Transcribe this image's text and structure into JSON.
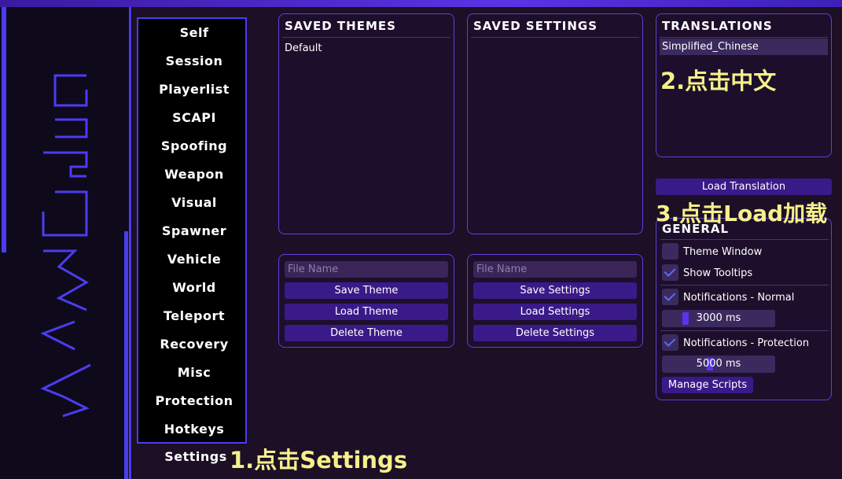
{
  "nav": {
    "items": [
      "Self",
      "Session",
      "Playerlist",
      "SCAPI",
      "Spoofing",
      "Weapon",
      "Visual",
      "Spawner",
      "Vehicle",
      "World",
      "Teleport",
      "Recovery",
      "Misc",
      "Protection",
      "Hotkeys",
      "Settings"
    ]
  },
  "themes": {
    "title": "SAVED THEMES",
    "items": [
      "Default"
    ],
    "file_placeholder": "File Name",
    "save": "Save Theme",
    "load": "Load Theme",
    "delete": "Delete Theme"
  },
  "settings": {
    "title": "SAVED SETTINGS",
    "file_placeholder": "File Name",
    "save": "Save Settings",
    "load": "Load Settings",
    "delete": "Delete Settings"
  },
  "translations": {
    "title": "TRANSLATIONS",
    "items": [
      "Simplified_Chinese"
    ],
    "load_button": "Load Translation"
  },
  "general": {
    "title": "GENERAL",
    "theme_window": {
      "label": "Theme Window",
      "checked": false
    },
    "show_tooltips": {
      "label": "Show Tooltips",
      "checked": true
    },
    "notif_normal": {
      "label": "Notifications - Normal",
      "checked": true,
      "value": "3000 ms"
    },
    "notif_protection": {
      "label": "Notifications - Protection",
      "checked": true,
      "value": "5000 ms"
    },
    "manage_scripts": "Manage Scripts"
  },
  "annotations": {
    "step1": "1.点击Settings",
    "step2": "2.点击中文",
    "step3": "3.点击Load加载"
  },
  "colors": {
    "accent": "#4b3cf0",
    "button": "#3a1a88",
    "panel_bg": "#1d0f2b",
    "note": "#f6f08a"
  }
}
